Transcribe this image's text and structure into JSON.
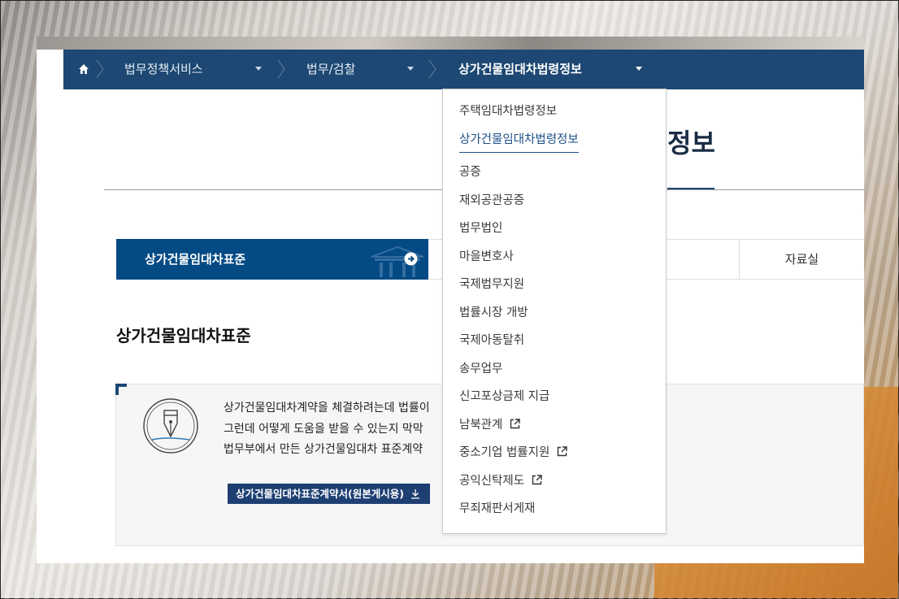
{
  "nav": {
    "home_icon": "home-icon",
    "items": [
      {
        "label": "법무정책서비스"
      },
      {
        "label": "법무/검찰"
      },
      {
        "label": "상가건물임대차법령정보"
      }
    ]
  },
  "page_title_partial": "정보",
  "tabs": {
    "active_label": "상가건물임대차표준",
    "data_room_label": "자료실"
  },
  "section_heading": "상가건물임대차표준",
  "info": {
    "lines": [
      "상가건물임대차계약을 체결하려는데 법률이",
      "그런데 어떻게 도움을 받을 수 있는지 막막",
      "법무부에서 만든 상가건물임대차 표준계약"
    ],
    "download_label": "상가건물임대차표준계약서(원본게시용)"
  },
  "dropdown": {
    "items": [
      {
        "label": "주택임대차법령정보",
        "external": false
      },
      {
        "label": "상가건물임대차법령정보",
        "external": false,
        "current": true
      },
      {
        "label": "공증",
        "external": false
      },
      {
        "label": "재외공관공증",
        "external": false
      },
      {
        "label": "법무법인",
        "external": false
      },
      {
        "label": "마을변호사",
        "external": false
      },
      {
        "label": "국제법무지원",
        "external": false
      },
      {
        "label": "법률시장 개방",
        "external": false
      },
      {
        "label": "국제아동탈취",
        "external": false
      },
      {
        "label": "송무업무",
        "external": false
      },
      {
        "label": "신고포상금제 지급",
        "external": false
      },
      {
        "label": "남북관계",
        "external": true
      },
      {
        "label": "중소기업 법률지원",
        "external": true
      },
      {
        "label": "공익신탁제도",
        "external": true
      },
      {
        "label": "무죄재판서게재",
        "external": false
      }
    ]
  },
  "colors": {
    "nav_bg": "#1d4873",
    "tab_active_bg": "#044a84",
    "button_bg": "#1d3f72",
    "dropdown_current": "#1d4f86"
  }
}
